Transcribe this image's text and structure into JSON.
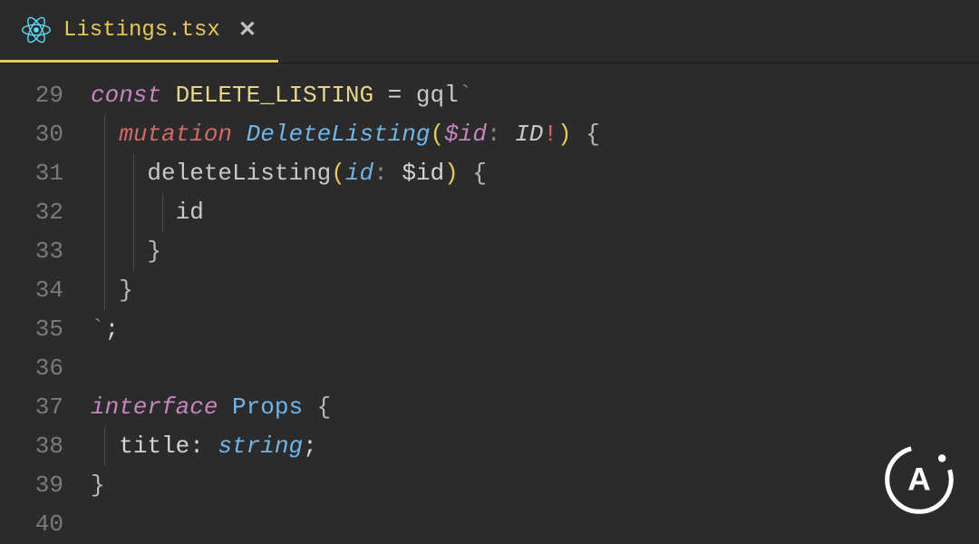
{
  "tab": {
    "filename": "Listings.tsx",
    "close_glyph": "✕"
  },
  "gutter": {
    "lines": [
      "29",
      "30",
      "31",
      "32",
      "33",
      "34",
      "35",
      "36",
      "37",
      "38",
      "39",
      "40"
    ]
  },
  "code": {
    "l29": {
      "kw": "const",
      "sp": " ",
      "name": "DELETE_LISTING",
      "eq": " = ",
      "fn": "gql",
      "tick": "`"
    },
    "l30": {
      "indent": "  ",
      "kw": "mutation",
      "sp": " ",
      "name": "DeleteListing",
      "lparen": "(",
      "var": "$id",
      "colon": ": ",
      "type": "ID",
      "bang": "!",
      "rparen": ")",
      "sp2": " ",
      "brace": "{"
    },
    "l31": {
      "indent": "    ",
      "field": "deleteListing",
      "lparen": "(",
      "param": "id",
      "colon": ": ",
      "var": "$id",
      "rparen": ")",
      "sp": " ",
      "brace": "{"
    },
    "l32": {
      "indent": "      ",
      "field": "id"
    },
    "l33": {
      "indent": "    ",
      "brace": "}"
    },
    "l34": {
      "indent": "  ",
      "brace": "}"
    },
    "l35": {
      "tick": "`",
      "semi": ";"
    },
    "l36": {
      "blank": ""
    },
    "l37": {
      "kw": "interface",
      "sp": " ",
      "name": "Props",
      "sp2": " ",
      "brace": "{"
    },
    "l38": {
      "indent": "  ",
      "prop": "title",
      "colon": ": ",
      "type": "string",
      "semi": ";"
    },
    "l39": {
      "brace": "}"
    }
  }
}
